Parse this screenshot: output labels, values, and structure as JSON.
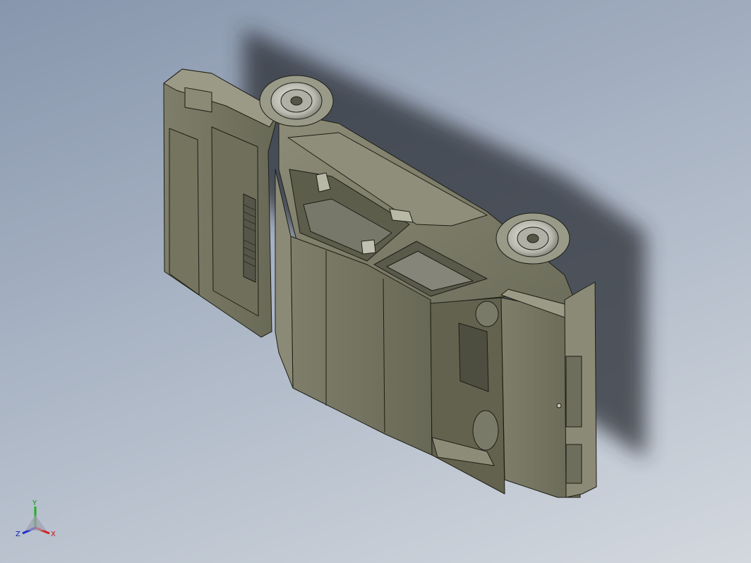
{
  "viewport": {
    "background_top": "#8796ad",
    "background_bottom": "#d3d8de",
    "model_color": "#7a7a68",
    "edge_color": "#1e1e16"
  },
  "triad": {
    "x_label": "X",
    "y_label": "Y",
    "z_label": "Z",
    "x_color": "#d42020",
    "y_color": "#20b020",
    "z_color": "#2030d0"
  }
}
